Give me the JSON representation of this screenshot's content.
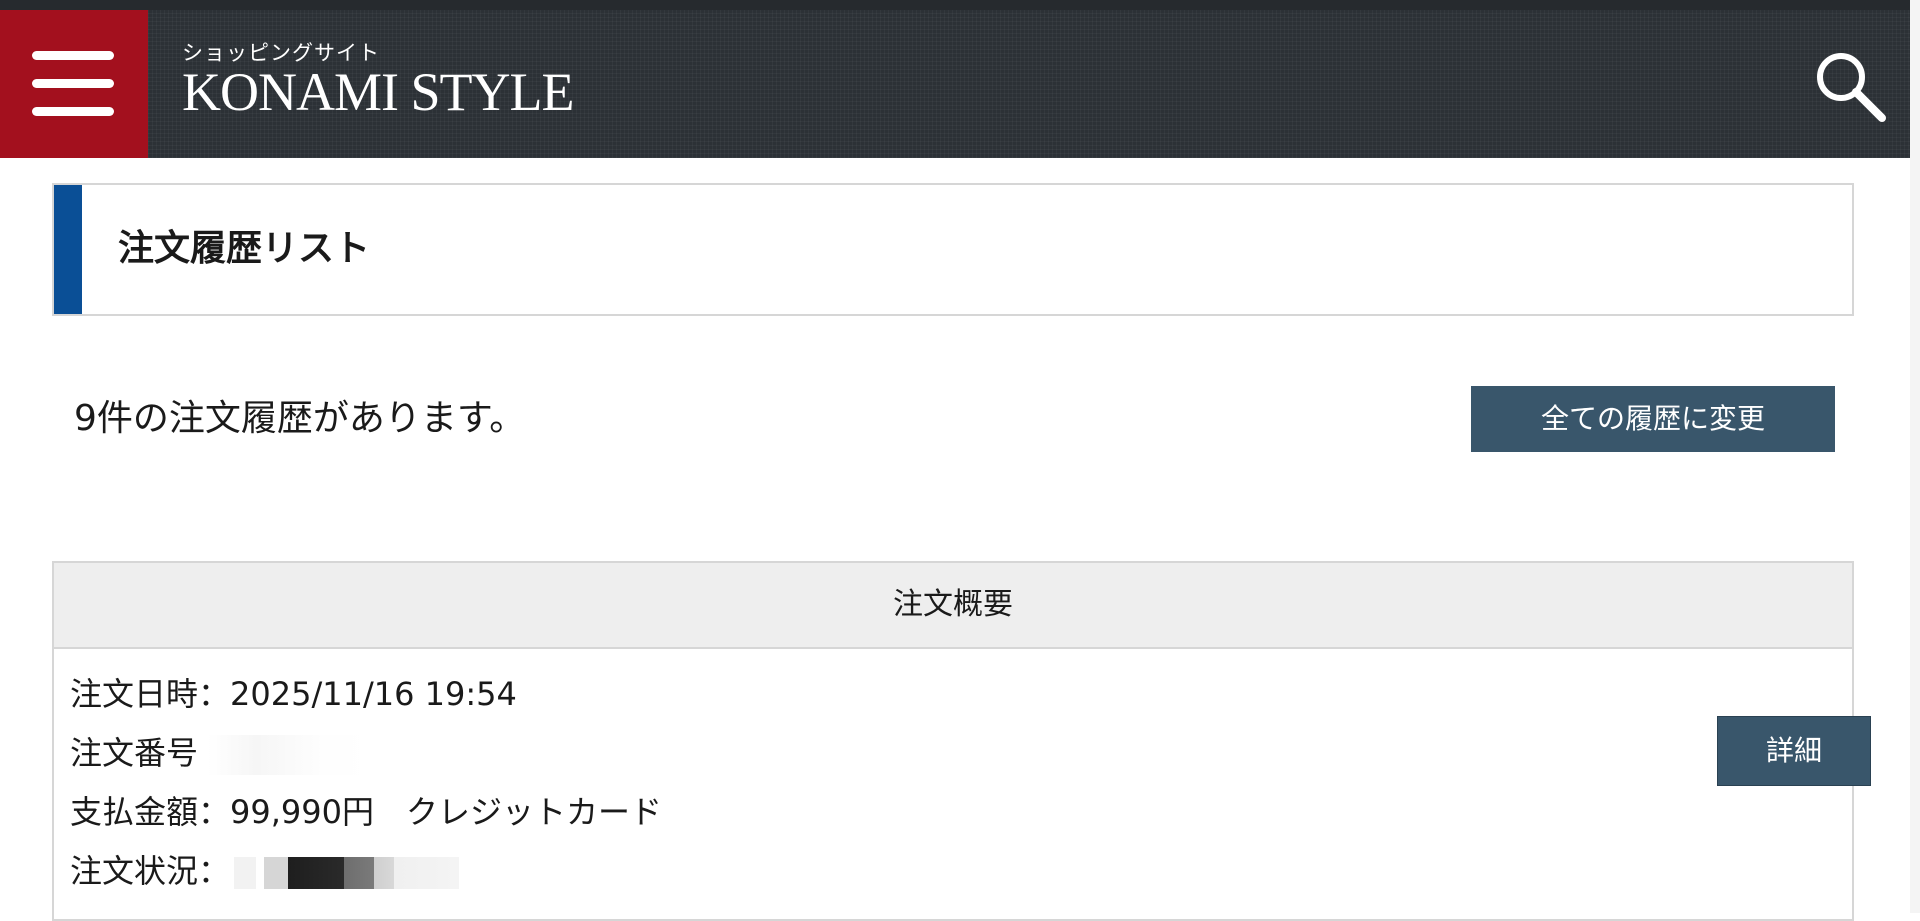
{
  "header": {
    "logo_sub": "ショッピングサイト",
    "logo_main": "KONAMI STYLE",
    "menu_icon": "hamburger-menu-icon",
    "search_icon": "search-icon",
    "menu_bg_color": "#a3101e",
    "header_bg_color": "#2c3136"
  },
  "page": {
    "title": "注文履歴リスト",
    "accent_color": "#0a4f96",
    "count_text": "9件の注文履歴があります。",
    "change_button_label": "全ての履歴に変更"
  },
  "summary": {
    "header": "注文概要",
    "order": {
      "date_label": "注文日時",
      "date_value": "2025/11/16 19:54",
      "number_label": "注文番号",
      "amount_label": "支払金額",
      "amount_value": "99,990円",
      "payment_method": "クレジットカード",
      "status_label": "注文状況",
      "separator": "：",
      "detail_button_label": "詳細"
    },
    "button_color": "#39566b"
  }
}
